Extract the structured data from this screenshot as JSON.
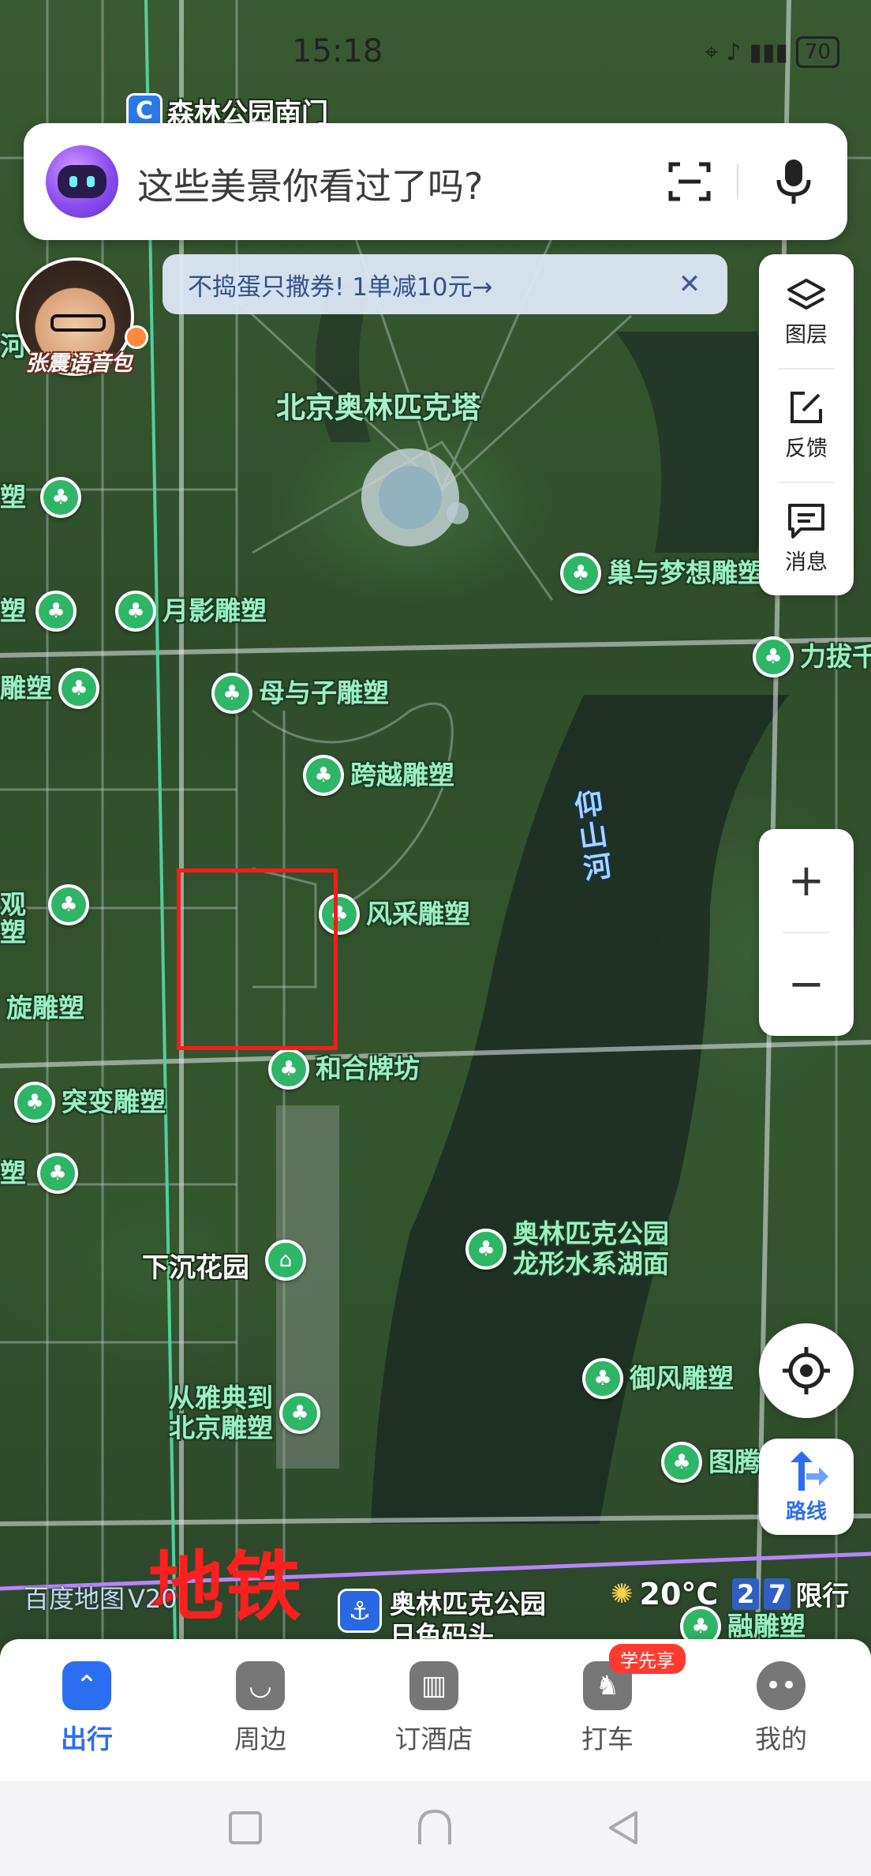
{
  "status_bar": {
    "time": "15:18",
    "battery": "70"
  },
  "top_station": {
    "badge": "C",
    "name": "森林公园南门"
  },
  "search": {
    "placeholder": "这些美景你看过了吗?"
  },
  "voice_pack": {
    "label": "张震语音包"
  },
  "promo": {
    "text": "不捣蛋只撒券!  1单减10元→",
    "close": "✕"
  },
  "tools": [
    {
      "label": "图层",
      "icon": "layers-icon"
    },
    {
      "label": "反馈",
      "icon": "feedback-icon"
    },
    {
      "label": "消息",
      "icon": "message-icon"
    }
  ],
  "zoom": {
    "in": "+",
    "out": "−"
  },
  "route": {
    "label": "路线"
  },
  "map": {
    "landmark": "北京奥林匹克塔",
    "river": "仰山河",
    "sunken_garden": "下沉花园",
    "pois": [
      {
        "name": "巢与梦想雕塑"
      },
      {
        "name": "月影雕塑"
      },
      {
        "name": "力拔千"
      },
      {
        "name": "雕塑"
      },
      {
        "name": "母与子雕塑"
      },
      {
        "name": "跨越雕塑"
      },
      {
        "name": "风采雕塑"
      },
      {
        "name": "观"
      },
      {
        "name": "旋雕塑"
      },
      {
        "name": "和合牌坊"
      },
      {
        "name": "突变雕塑"
      },
      {
        "name": "塑"
      },
      {
        "name": "奥林匹克公园\n龙形水系湖面"
      },
      {
        "name": "御风雕塑"
      },
      {
        "name": "从雅典到\n北京雕塑"
      },
      {
        "name": "图腾"
      },
      {
        "name": "融雕塑"
      }
    ],
    "edge_labels": [
      "河",
      "塑",
      "塑",
      "塑"
    ],
    "scale_label": "百度地图",
    "scale_value": "V20"
  },
  "annotation": {
    "subway": "地铁"
  },
  "weather": {
    "temp": "20°C",
    "limit_digits": [
      "2",
      "7"
    ],
    "limit_label": "限行"
  },
  "pier": {
    "name": "奥林匹克公园\n日色码头"
  },
  "bottom_nav": {
    "items": [
      {
        "label": "出行",
        "active": true
      },
      {
        "label": "周边",
        "active": false
      },
      {
        "label": "订酒店",
        "active": false
      },
      {
        "label": "打车",
        "active": false
      },
      {
        "label": "我的",
        "active": false
      }
    ],
    "taxi_badge": "学先享"
  },
  "colors": {
    "accent": "#2c6ef2",
    "poi_green": "#2fb566",
    "annotation_red": "#ff1f1f"
  }
}
